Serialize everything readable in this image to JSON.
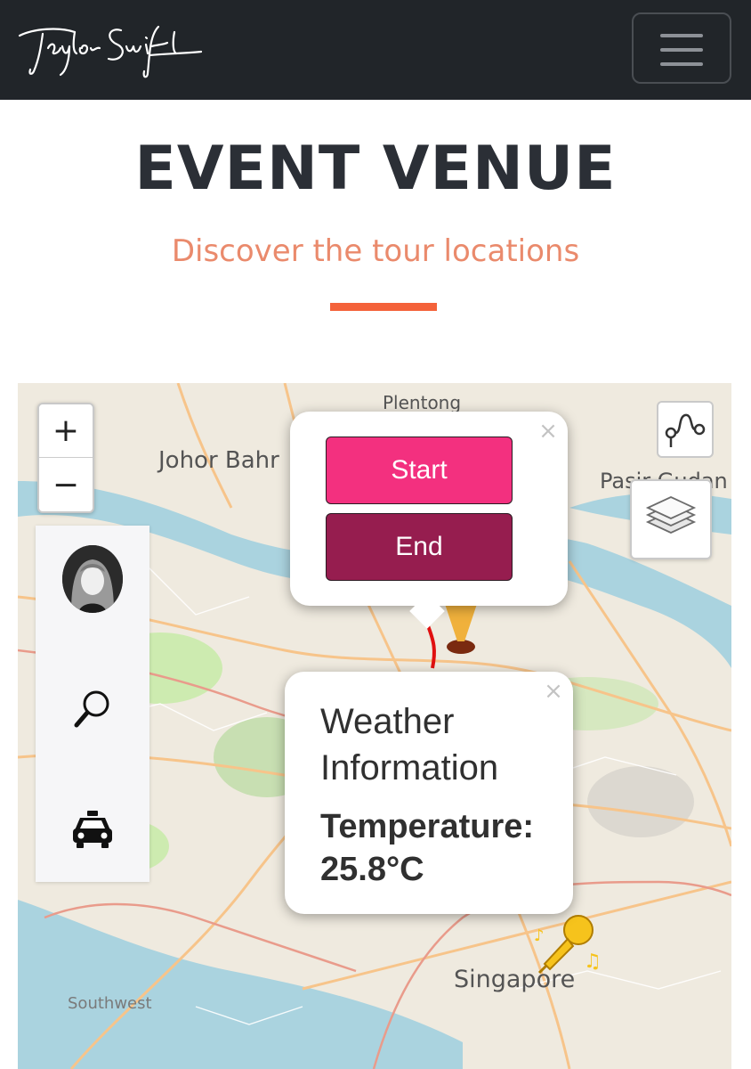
{
  "navbar": {
    "brand": "Taylor Swift",
    "menu_icon": "hamburger-icon"
  },
  "header": {
    "title": "EVENT VENUE",
    "subtitle": "Discover the tour locations",
    "accent_color": "#f4623a",
    "subtitle_color": "#ea8a6c"
  },
  "map": {
    "zoom_in": "+",
    "zoom_out": "−",
    "labels": {
      "plentong": "Plentong",
      "johor_bahru": "Johor Bahr",
      "pasir_gudang": "Pasir Gudan",
      "singapore": "Singapore",
      "southwest": "Southwest"
    },
    "side_panel": {
      "items": [
        "avatar",
        "search-icon",
        "taxi-icon"
      ]
    },
    "controls": {
      "route_icon": "route-icon",
      "layers_icon": "layers-icon"
    },
    "route_popup": {
      "close": "×",
      "start_label": "Start",
      "end_label": "End",
      "start_color": "#f3307f",
      "end_color": "#961d4f"
    },
    "weather_popup": {
      "close": "×",
      "title": "Weather Information",
      "temperature_label": "Temperature:",
      "temperature_value": "25.8°C"
    }
  }
}
